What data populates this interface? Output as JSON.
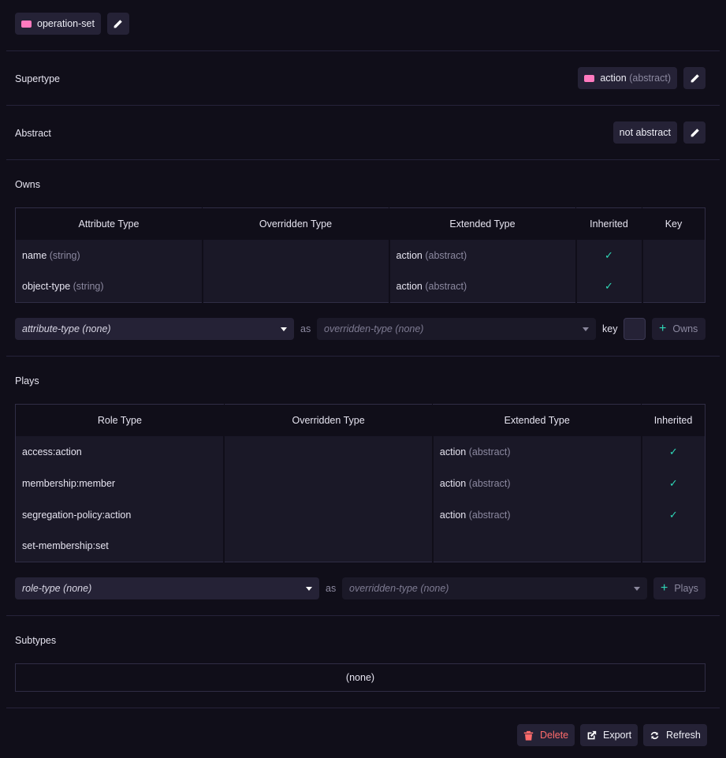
{
  "header": {
    "type_name": "operation-set"
  },
  "supertype": {
    "label": "Supertype",
    "value": "action",
    "qualifier": "(abstract)"
  },
  "abstract": {
    "label": "Abstract",
    "value": "not abstract"
  },
  "owns": {
    "label": "Owns",
    "columns": [
      "Attribute Type",
      "Overridden Type",
      "Extended Type",
      "Inherited",
      "Key"
    ],
    "rows": [
      {
        "attr": "name",
        "attr_type": "(string)",
        "overridden": "",
        "extended": "action",
        "extended_q": "(abstract)",
        "inherited": true,
        "key": false
      },
      {
        "attr": "object-type",
        "attr_type": "(string)",
        "overridden": "",
        "extended": "action",
        "extended_q": "(abstract)",
        "inherited": true,
        "key": false
      }
    ],
    "form": {
      "attribute_placeholder": "attribute-type (none)",
      "as_label": "as",
      "overridden_placeholder": "overridden-type (none)",
      "key_label": "key",
      "add_label": "Owns"
    }
  },
  "plays": {
    "label": "Plays",
    "columns": [
      "Role Type",
      "Overridden Type",
      "Extended Type",
      "Inherited"
    ],
    "rows": [
      {
        "role": "access:action",
        "overridden": "",
        "extended": "action",
        "extended_q": "(abstract)",
        "inherited": true
      },
      {
        "role": "membership:member",
        "overridden": "",
        "extended": "action",
        "extended_q": "(abstract)",
        "inherited": true
      },
      {
        "role": "segregation-policy:action",
        "overridden": "",
        "extended": "action",
        "extended_q": "(abstract)",
        "inherited": true
      },
      {
        "role": "set-membership:set",
        "overridden": "",
        "extended": "",
        "extended_q": "",
        "inherited": false
      }
    ],
    "form": {
      "role_placeholder": "role-type (none)",
      "as_label": "as",
      "overridden_placeholder": "overridden-type (none)",
      "add_label": "Plays"
    }
  },
  "subtypes": {
    "label": "Subtypes",
    "empty": "(none)"
  },
  "actions": {
    "delete": "Delete",
    "export": "Export",
    "refresh": "Refresh"
  },
  "colors": {
    "background": "#100e19",
    "entity_swatch": "#ff7abf",
    "check": "#2fd8b8",
    "danger": "#ff6b6b"
  }
}
